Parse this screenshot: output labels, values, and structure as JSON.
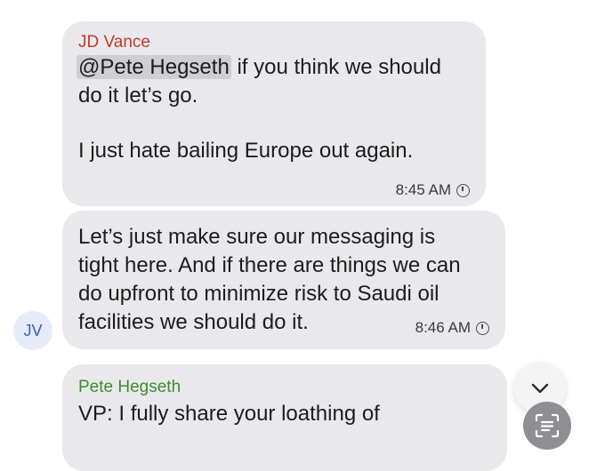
{
  "messages": [
    {
      "sender": "JD Vance",
      "mention": "@Pete Hegseth",
      "line1_rest": " if you think we should",
      "line2": "do it let’s go.",
      "para2": "I just hate bailing Europe out again.",
      "time": "8:45 AM"
    },
    {
      "lines": [
        "Let’s just make sure our messaging is",
        "tight here. And if there are things we can",
        "do upfront to minimize risk to Saudi oil",
        "facilities we should do it."
      ],
      "time": "8:46 AM"
    },
    {
      "sender": "Pete Hegseth",
      "line1": "VP: I fully share your loathing of"
    }
  ],
  "avatar": {
    "initials": "JV"
  },
  "controls": {
    "scroll_icon": "chevron-down-icon",
    "live_text_icon": "live-text-icon"
  },
  "colors": {
    "bubble": "#e9e9eb",
    "jd_name": "#c0392b",
    "pete_name": "#3d8c2d",
    "avatar_bg": "#e6ebfa",
    "avatar_text": "#3b5bc4"
  }
}
